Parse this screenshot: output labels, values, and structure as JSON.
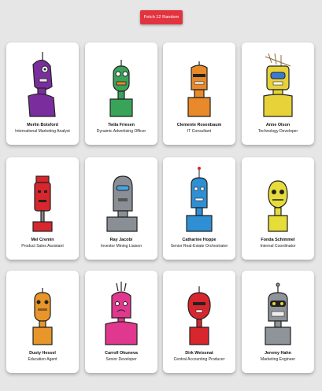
{
  "toolbar": {
    "fetch_label": "Fetch 12 Random"
  },
  "robots": [
    {
      "name": "Merlin Botsford",
      "title": "International Marketing Analyst",
      "color": "#7a2e9e"
    },
    {
      "name": "Twila Friesen",
      "title": "Dynamic Advertising Officer",
      "color": "#3aa35a"
    },
    {
      "name": "Clemente Rosenbaum",
      "title": "IT Consultant",
      "color": "#e8892a"
    },
    {
      "name": "Anne Olson",
      "title": "Technology Developer",
      "color": "#e8d23a"
    },
    {
      "name": "Mel Cremin",
      "title": "Product Sales Assistant",
      "color": "#d8262e"
    },
    {
      "name": "Ray Jacobi",
      "title": "Investor Mining Liaison",
      "color": "#8a8f96"
    },
    {
      "name": "Catharine Hoppe",
      "title": "Senior Real-Estate Orchestrator",
      "color": "#2f8fd4"
    },
    {
      "name": "Fonda Schimmel",
      "title": "Internal Coordinator",
      "color": "#e6dc3a"
    },
    {
      "name": "Dusty Hessel",
      "title": "Education Agent",
      "color": "#e8962a"
    },
    {
      "name": "Carroll Okuneva",
      "title": "Senior Developer",
      "color": "#e0388e"
    },
    {
      "name": "Dirk Weissnat",
      "title": "Central Accounting Producer",
      "color": "#d8262e"
    },
    {
      "name": "Jeremy Hahn",
      "title": "Marketing Engineer",
      "color": "#8f949a"
    }
  ]
}
